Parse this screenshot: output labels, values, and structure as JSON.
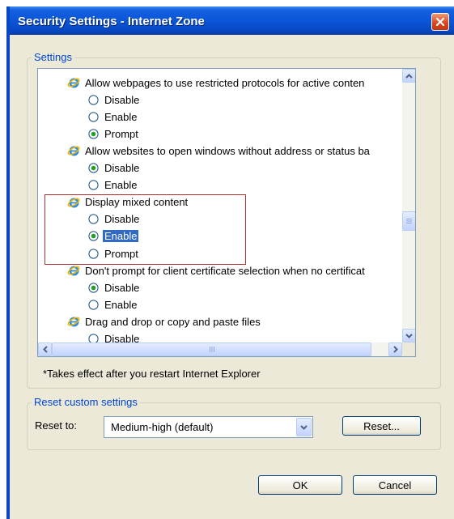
{
  "window": {
    "title": "Security Settings - Internet Zone"
  },
  "settings": {
    "legend": "Settings",
    "items": [
      {
        "type": "header",
        "text": "Allow webpages to use restricted protocols for active conten"
      },
      {
        "type": "option",
        "text": "Disable",
        "checked": false
      },
      {
        "type": "option",
        "text": "Enable",
        "checked": false
      },
      {
        "type": "option",
        "text": "Prompt",
        "checked": true
      },
      {
        "type": "header",
        "text": "Allow websites to open windows without address or status ba"
      },
      {
        "type": "option",
        "text": "Disable",
        "checked": true
      },
      {
        "type": "option",
        "text": "Enable",
        "checked": false
      },
      {
        "type": "header",
        "text": "Display mixed content"
      },
      {
        "type": "option",
        "text": "Disable",
        "checked": false
      },
      {
        "type": "option",
        "text": "Enable",
        "checked": true,
        "selected": true
      },
      {
        "type": "option",
        "text": "Prompt",
        "checked": false
      },
      {
        "type": "header",
        "text": "Don't prompt for client certificate selection when no certificat"
      },
      {
        "type": "option",
        "text": "Disable",
        "checked": true
      },
      {
        "type": "option",
        "text": "Enable",
        "checked": false
      },
      {
        "type": "header",
        "text": "Drag and drop or copy and paste files"
      },
      {
        "type": "option",
        "text": "Disable",
        "checked": false
      }
    ],
    "note": "*Takes effect after you restart Internet Explorer"
  },
  "reset": {
    "legend": "Reset custom settings",
    "label": "Reset to:",
    "selected": "Medium-high (default)",
    "button": "Reset..."
  },
  "buttons": {
    "ok": "OK",
    "cancel": "Cancel"
  },
  "colors": {
    "accent": "#0a56d8",
    "selection": "#316ac5",
    "legend": "#0046d5",
    "highlight_box": "#b03030"
  }
}
